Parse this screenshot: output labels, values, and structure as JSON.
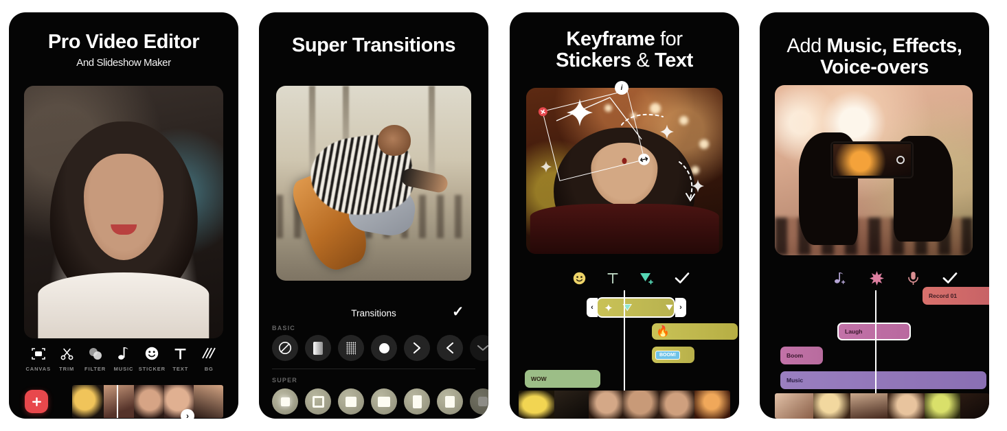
{
  "panels": [
    {
      "id": "pro-video-editor",
      "title": "Pro Video Editor",
      "subtitle": "And Slideshow Maker",
      "toolbar": [
        {
          "label": "CANVAS",
          "icon": "canvas-icon"
        },
        {
          "label": "TRIM",
          "icon": "scissors-icon"
        },
        {
          "label": "FILTER",
          "icon": "filter-icon"
        },
        {
          "label": "MUSIC",
          "icon": "music-note-icon"
        },
        {
          "label": "STICKER",
          "icon": "smiley-icon"
        },
        {
          "label": "TEXT",
          "icon": "text-icon"
        },
        {
          "label": "BG",
          "icon": "diagonal-lines-icon"
        }
      ],
      "add_button": "+",
      "expand_arrow": "›"
    },
    {
      "id": "super-transitions",
      "title": "Super Transitions",
      "sheet_title": "Transitions",
      "confirm": "✓",
      "sections": [
        {
          "label": "BASIC",
          "items": [
            {
              "name": "none-transition",
              "glyph": "⃠"
            },
            {
              "name": "fade-transition",
              "glyph": "▯"
            },
            {
              "name": "dissolve-transition",
              "glyph": "░"
            },
            {
              "name": "circle-transition",
              "glyph": "●"
            },
            {
              "name": "slide-right-transition",
              "glyph": "›"
            },
            {
              "name": "slide-left-transition",
              "glyph": "‹"
            },
            {
              "name": "slide-down-transition",
              "glyph": "⌄"
            }
          ]
        },
        {
          "label": "SUPER",
          "items": [
            {
              "name": "super-zoom-transition",
              "glyph": "▣"
            },
            {
              "name": "super-frame-transition",
              "glyph": "▣"
            },
            {
              "name": "super-box-transition",
              "glyph": "■"
            },
            {
              "name": "super-wide-transition",
              "glyph": "■"
            },
            {
              "name": "super-tall-transition",
              "glyph": "■"
            },
            {
              "name": "super-square-transition",
              "glyph": "■"
            },
            {
              "name": "super-more-transition",
              "glyph": "■"
            }
          ]
        }
      ]
    },
    {
      "id": "keyframe",
      "title_line1_bold": "Keyframe",
      "title_line1_thin": "for",
      "title_line2_bold_a": "Stickers",
      "title_line2_thin": "&",
      "title_line2_bold_b": "Text",
      "toolbar": [
        {
          "name": "sticker-tool",
          "glyph": "🙂"
        },
        {
          "name": "text-tool",
          "glyph": "T"
        },
        {
          "name": "add-shape-tool",
          "glyph": "▼"
        },
        {
          "name": "confirm-button",
          "glyph": "✓"
        }
      ],
      "keyframe_badge": "i",
      "selected_clip_label": "",
      "clips": [
        {
          "label": "",
          "name": "fire-sticker-clip"
        },
        {
          "label": "",
          "name": "boom-sticker-clip"
        },
        {
          "label": "WOW",
          "name": "wow-text-clip"
        }
      ]
    },
    {
      "id": "music-effects",
      "title_thin": "Add",
      "title_bold_a": "Music, Effects,",
      "title_bold_b": "Voice-overs",
      "toolbar": [
        {
          "name": "music-tool",
          "glyph": "♪"
        },
        {
          "name": "effects-tool",
          "glyph": "✸"
        },
        {
          "name": "voice-over-tool",
          "glyph": "🎤"
        },
        {
          "name": "confirm-button",
          "glyph": "✓"
        }
      ],
      "clips": [
        {
          "label": "Record 01",
          "name": "record-clip"
        },
        {
          "label": "Laugh",
          "name": "laugh-clip"
        },
        {
          "label": "Boom",
          "name": "boom-clip"
        },
        {
          "label": "Music",
          "name": "music-clip"
        }
      ]
    }
  ],
  "colors": {
    "card_bg": "#050505",
    "accent_red": "#e8484c",
    "clip_yellow": "#c9c257",
    "clip_green": "#9cbe87",
    "clip_pink": "#c272a8",
    "clip_purple": "#9a7fc0",
    "clip_salmon": "#d9716c",
    "text_muted": "#8d8d8d"
  }
}
